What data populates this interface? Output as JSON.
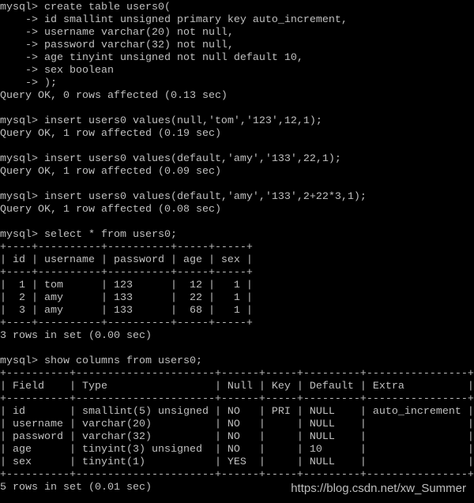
{
  "prompt": "mysql> ",
  "continuation": "    -> ",
  "blocks": [
    {
      "command": [
        "create table users0(",
        "id smallint unsigned primary key auto_increment,",
        "username varchar(20) not null,",
        "password varchar(32) not null,",
        "age tinyint unsigned not null default 10,",
        "sex boolean",
        ");"
      ],
      "result": "Query OK, 0 rows affected (0.13 sec)"
    },
    {
      "command": [
        "insert users0 values(null,'tom','123',12,1);"
      ],
      "result": "Query OK, 1 row affected (0.19 sec)"
    },
    {
      "command": [
        "insert users0 values(default,'amy','133',22,1);"
      ],
      "result": "Query OK, 1 row affected (0.09 sec)"
    },
    {
      "command": [
        "insert users0 values(default,'amy','133',2+22*3,1);"
      ],
      "result": "Query OK, 1 row affected (0.08 sec)"
    },
    {
      "command": [
        "select * from users0;"
      ],
      "table": {
        "columns": [
          "id",
          "username",
          "password",
          "age",
          "sex"
        ],
        "align": [
          "r",
          "l",
          "l",
          "r",
          "r"
        ],
        "rows": [
          [
            "1",
            "tom",
            "123",
            "12",
            "1"
          ],
          [
            "2",
            "amy",
            "133",
            "22",
            "1"
          ],
          [
            "3",
            "amy",
            "133",
            "68",
            "1"
          ]
        ]
      },
      "result": "3 rows in set (0.00 sec)"
    },
    {
      "command": [
        "show columns from users0;"
      ],
      "table": {
        "columns": [
          "Field",
          "Type",
          "Null",
          "Key",
          "Default",
          "Extra"
        ],
        "align": [
          "l",
          "l",
          "l",
          "l",
          "l",
          "l"
        ],
        "rows": [
          [
            "id",
            "smallint(5) unsigned",
            "NO",
            "PRI",
            "NULL",
            "auto_increment"
          ],
          [
            "username",
            "varchar(20)",
            "NO",
            "",
            "NULL",
            ""
          ],
          [
            "password",
            "varchar(32)",
            "NO",
            "",
            "NULL",
            ""
          ],
          [
            "age",
            "tinyint(3) unsigned",
            "NO",
            "",
            "10",
            ""
          ],
          [
            "sex",
            "tinyint(1)",
            "YES",
            "",
            "NULL",
            ""
          ]
        ]
      },
      "result": "5 rows in set (0.01 sec)"
    }
  ],
  "watermark": "https://blog.csdn.net/xw_Summer",
  "colors": {
    "background": "#000000",
    "text": "#c0c0c0"
  }
}
